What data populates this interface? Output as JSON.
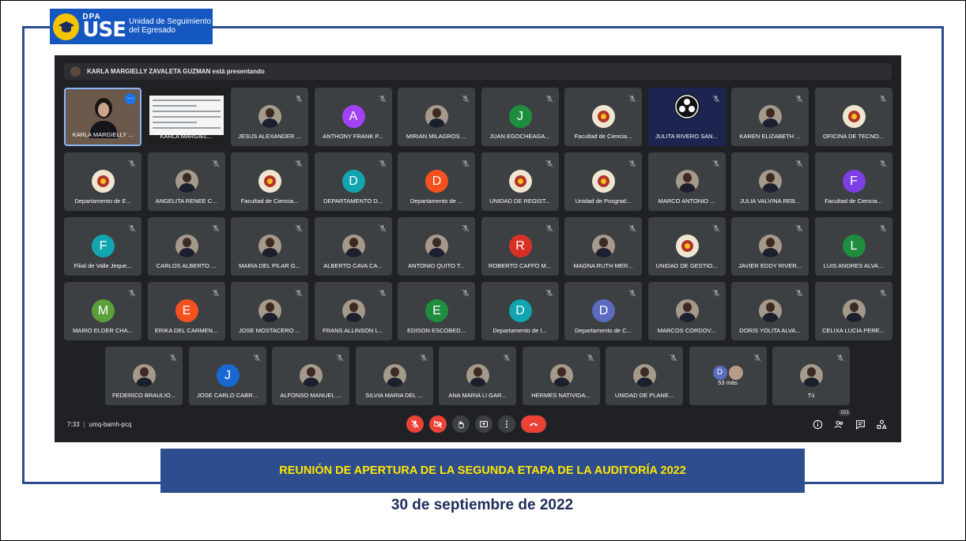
{
  "logo": {
    "dpa": "DPA",
    "use": "USE",
    "subtitle": "Unidad de Seguimiento del Egresado"
  },
  "meet": {
    "presenting_banner": "KARLA MARGIELLY ZAVALETA GUZMAN está presentando",
    "tiles": [
      {
        "name": "KARLA MARGIELLY ...",
        "kind": "self",
        "row": 0,
        "col": 0
      },
      {
        "name": "KARLA MARGIEL...",
        "kind": "screen",
        "row": 0,
        "col": 1
      },
      {
        "name": "JESUS ALEXANDER ...",
        "kind": "photo",
        "row": 0,
        "col": 2
      },
      {
        "name": "ANTHONY FRANK P...",
        "kind": "initial",
        "initial": "A",
        "color": "#a142f4",
        "row": 0,
        "col": 3
      },
      {
        "name": "MIRIAN MILAGROS ...",
        "kind": "photo",
        "row": 0,
        "col": 4
      },
      {
        "name": "JUAN EGOCHEAGA...",
        "kind": "initial",
        "initial": "J",
        "color": "#1e8e3e",
        "row": 0,
        "col": 5
      },
      {
        "name": "Facultad de Ciencia...",
        "kind": "logo",
        "row": 0,
        "col": 6
      },
      {
        "name": "JULITA RIVERO SAN...",
        "kind": "julita",
        "row": 0,
        "col": 7
      },
      {
        "name": "KAREN ELIZABETH ...",
        "kind": "photo",
        "row": 0,
        "col": 8
      },
      {
        "name": "OFICINA DE TECNO...",
        "kind": "logo",
        "row": 0,
        "col": 9
      },
      {
        "name": "Departamento de E...",
        "kind": "logo",
        "row": 1,
        "col": 0
      },
      {
        "name": "ANGELITA RENEE C...",
        "kind": "photo",
        "row": 1,
        "col": 1
      },
      {
        "name": "Facultad de Ciencia...",
        "kind": "logo",
        "row": 1,
        "col": 2
      },
      {
        "name": "DEPARTAMENTO D...",
        "kind": "initial",
        "initial": "D",
        "color": "#12a4af",
        "row": 1,
        "col": 3
      },
      {
        "name": "Departamento de ...",
        "kind": "initial",
        "initial": "D",
        "color": "#f4511e",
        "row": 1,
        "col": 4
      },
      {
        "name": "UNIDAD DE REGIST...",
        "kind": "logo",
        "row": 1,
        "col": 5
      },
      {
        "name": "Unidad de Posgrad...",
        "kind": "logo",
        "row": 1,
        "col": 6
      },
      {
        "name": "MARCO ANTONIO ...",
        "kind": "photo",
        "row": 1,
        "col": 7
      },
      {
        "name": "JULIA VALVINA REB...",
        "kind": "photo",
        "row": 1,
        "col": 8
      },
      {
        "name": "Facultad de Ciencia...",
        "kind": "initial",
        "initial": "F",
        "color": "#7b3fe4",
        "row": 1,
        "col": 9
      },
      {
        "name": "Filial de Valle Jeque...",
        "kind": "initial",
        "initial": "F",
        "color": "#12a4af",
        "row": 2,
        "col": 0
      },
      {
        "name": "CARLOS ALBERTO ...",
        "kind": "photo",
        "row": 2,
        "col": 1
      },
      {
        "name": "MARIA DEL PILAR G...",
        "kind": "photo",
        "row": 2,
        "col": 2
      },
      {
        "name": "ALBERTO CAVA CA...",
        "kind": "photo",
        "row": 2,
        "col": 3
      },
      {
        "name": "ANTONIO QUITO T...",
        "kind": "photo",
        "row": 2,
        "col": 4
      },
      {
        "name": "ROBERTO CAFFO M...",
        "kind": "initial",
        "initial": "R",
        "color": "#d93025",
        "row": 2,
        "col": 5
      },
      {
        "name": "MAGNA RUTH MER...",
        "kind": "photo",
        "row": 2,
        "col": 6
      },
      {
        "name": "UNIDAD DE GESTIO...",
        "kind": "logo",
        "row": 2,
        "col": 7
      },
      {
        "name": "JAVIER EDDY RIVER...",
        "kind": "photo",
        "row": 2,
        "col": 8
      },
      {
        "name": "LUIS ANDRES ALVA...",
        "kind": "initial",
        "initial": "L",
        "color": "#1e8e3e",
        "row": 2,
        "col": 9
      },
      {
        "name": "MARIO ELDER CHA...",
        "kind": "initial",
        "initial": "M",
        "color": "#5b9f3a",
        "row": 3,
        "col": 0
      },
      {
        "name": "ERIKA DEL CARMEN...",
        "kind": "initial",
        "initial": "E",
        "color": "#f4511e",
        "row": 3,
        "col": 1
      },
      {
        "name": "JOSE MOSTACERO ...",
        "kind": "photo",
        "row": 3,
        "col": 2
      },
      {
        "name": "FRANS ALLINSON L...",
        "kind": "photo",
        "row": 3,
        "col": 3
      },
      {
        "name": "EDISON ESCOBED...",
        "kind": "initial",
        "initial": "E",
        "color": "#1e8e3e",
        "row": 3,
        "col": 4
      },
      {
        "name": "Departamento de I...",
        "kind": "initial",
        "initial": "D",
        "color": "#12a4af",
        "row": 3,
        "col": 5
      },
      {
        "name": "Departamento de C...",
        "kind": "initial",
        "initial": "D",
        "color": "#5c6bc0",
        "row": 3,
        "col": 6
      },
      {
        "name": "MARCOS CORDOV...",
        "kind": "photo",
        "row": 3,
        "col": 7
      },
      {
        "name": "DORIS YOLITA ALVA...",
        "kind": "photo",
        "row": 3,
        "col": 8
      },
      {
        "name": "CELIXA LUCIA PERE...",
        "kind": "photo",
        "row": 3,
        "col": 9
      },
      {
        "name": "FEDERICO BRAULIO...",
        "kind": "photo",
        "row": 4,
        "col": 0
      },
      {
        "name": "JOSE CARLO CABR...",
        "kind": "initial",
        "initial": "J",
        "color": "#1967d2",
        "row": 4,
        "col": 1
      },
      {
        "name": "ALFONSO MANUEL ...",
        "kind": "photo",
        "row": 4,
        "col": 2
      },
      {
        "name": "SILVIA MARIA DEL ...",
        "kind": "photo",
        "row": 4,
        "col": 3
      },
      {
        "name": "ANA MARIA LI GAR...",
        "kind": "photo",
        "row": 4,
        "col": 4
      },
      {
        "name": "HERMES NATIVIDA...",
        "kind": "photo",
        "row": 4,
        "col": 5
      },
      {
        "name": "UNIDAD DE PLANE...",
        "kind": "photo",
        "row": 4,
        "col": 6
      },
      {
        "name": "53 más",
        "kind": "more",
        "row": 4,
        "col": 7
      },
      {
        "name": "Tú",
        "kind": "photo",
        "row": 4,
        "col": 8
      }
    ],
    "more_initial": "D",
    "time": "7:33",
    "meeting_code": "umq-bamh-pcq",
    "participant_count": "101",
    "icons": {
      "mic": "mic-off-icon",
      "cam": "camera-off-icon",
      "hand": "raise-hand-icon",
      "present": "present-screen-icon",
      "more": "more-options-icon",
      "end": "end-call-icon",
      "info": "info-icon",
      "people": "people-icon",
      "chat": "chat-icon",
      "activities": "activities-icon"
    },
    "colors": {
      "background": "#202124",
      "tile": "#3c4043",
      "danger": "#ea4335"
    }
  },
  "banner": "REUNIÓN DE APERTURA DE LA SEGUNDA ETAPA DE LA AUDITORÍA 2022",
  "date": "30 de septiembre de 2022",
  "colors": {
    "frame": "#2e4d8f",
    "banner_text": "#ffe600",
    "date_text": "#1f2d5a",
    "logo_bg": "#1557c0"
  }
}
